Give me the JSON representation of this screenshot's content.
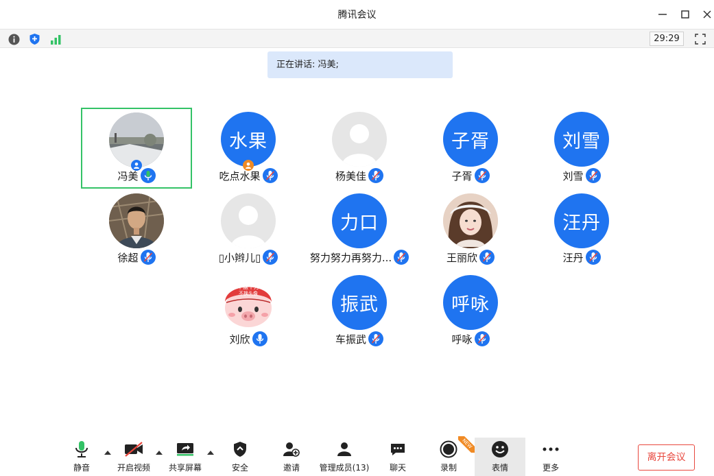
{
  "window": {
    "title": "腾讯会议"
  },
  "infobar": {
    "timer": "29:29"
  },
  "speaking": {
    "label": "正在讲话:",
    "name": "冯美;"
  },
  "colors": {
    "accent": "#1f74f0",
    "active_border": "#33c266",
    "leave": "#e8463c",
    "mic_active": "#33c266"
  },
  "participants": [
    {
      "name": "冯美",
      "avatar_type": "photo-landscape",
      "mic": "active",
      "host_badge": true,
      "active": true
    },
    {
      "name": "吃点水果",
      "avatar_type": "text",
      "avatar_text": "水果",
      "mic": "muted",
      "host_badge_orange": true
    },
    {
      "name": "杨美佳",
      "avatar_type": "default",
      "mic": "muted"
    },
    {
      "name": "子胥",
      "avatar_type": "text",
      "avatar_text": "子胥",
      "mic": "muted"
    },
    {
      "name": "刘雪",
      "avatar_type": "text",
      "avatar_text": "刘雪",
      "mic": "muted"
    },
    {
      "name": "徐超",
      "avatar_type": "photo-man",
      "mic": "muted"
    },
    {
      "name": "▯小辫儿▯",
      "avatar_type": "default",
      "mic": "muted"
    },
    {
      "name": "努力努力再努力...",
      "avatar_type": "text",
      "avatar_text": "力口",
      "mic": "muted"
    },
    {
      "name": "王丽欣",
      "avatar_type": "photo-woman",
      "mic": "muted"
    },
    {
      "name": "汪丹",
      "avatar_type": "text",
      "avatar_text": "汪丹",
      "mic": "muted"
    },
    {
      "name": "刘欣",
      "avatar_type": "photo-pig",
      "avatar_caption_1": "不盘十万",
      "avatar_caption_2": "不换头像",
      "mic": "unmuted"
    },
    {
      "name": "车振武",
      "avatar_type": "text",
      "avatar_text": "振武",
      "mic": "muted"
    },
    {
      "name": "呼咏",
      "avatar_type": "text",
      "avatar_text": "呼咏",
      "mic": "muted"
    }
  ],
  "toolbar": {
    "mute": "静音",
    "video": "开启视频",
    "share": "共享屏幕",
    "security": "安全",
    "invite": "邀请",
    "members": "管理成员(13)",
    "chat": "聊天",
    "record": "录制",
    "record_badge": "NEW",
    "emoji": "表情",
    "more": "更多",
    "leave": "离开会议"
  }
}
